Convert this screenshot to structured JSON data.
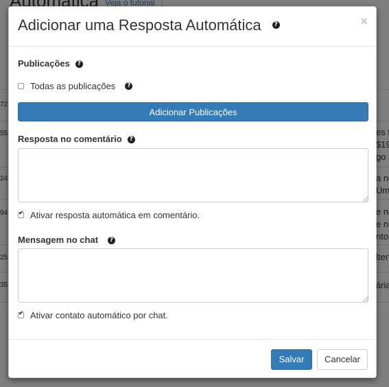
{
  "background": {
    "page_title": "Automáticas",
    "tutorial_link": "Veja o tutorial",
    "left_fragments": [
      "72",
      "55",
      "24",
      "94",
      "25",
      "35"
    ],
    "right_fragments": [
      [
        "es ti",
        "$19",
        "go a"
      ],
      [
        "a no",
        "Um"
      ],
      [
        "e no",
        "e n",
        "nto"
      ],
      [
        "lter"
      ],
      [
        "ária"
      ]
    ]
  },
  "modal": {
    "title": "Adicionar uma Resposta Automática",
    "close_label": "×",
    "publications": {
      "label": "Publicações",
      "all_label": "Todas as publicações",
      "all_checked": false,
      "add_button": "Adicionar Publicações"
    },
    "comment_reply": {
      "label": "Resposta no comentário",
      "value": "",
      "auto_label": "Ativar resposta automática em comentário.",
      "auto_checked": true
    },
    "chat_message": {
      "label": "Mensagem no chat",
      "value": "",
      "auto_label": "Ativar contato automático por chat.",
      "auto_checked": true
    },
    "footer": {
      "save": "Salvar",
      "cancel": "Cancelar"
    }
  }
}
